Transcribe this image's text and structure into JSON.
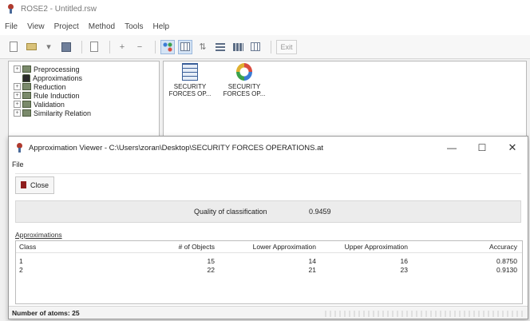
{
  "app": {
    "title": "ROSE2 - Untitled.rsw",
    "menu": [
      "File",
      "View",
      "Project",
      "Method",
      "Tools",
      "Help"
    ],
    "toolbar_text_button": "Exit"
  },
  "tree": {
    "items": [
      {
        "label": "Preprocessing",
        "expander": "+",
        "icon": "folder-icon"
      },
      {
        "label": "Approximations",
        "expander": "",
        "icon": "runner-icon"
      },
      {
        "label": "Reduction",
        "expander": "+",
        "icon": "folder-icon"
      },
      {
        "label": "Rule Induction",
        "expander": "+",
        "icon": "folder-icon"
      },
      {
        "label": "Validation",
        "expander": "+",
        "icon": "folder-icon"
      },
      {
        "label": "Similarity Relation",
        "expander": "+",
        "icon": "folder-icon"
      }
    ]
  },
  "workspace": {
    "items": [
      {
        "label_line1": "SECURITY",
        "label_line2": "FORCES OP...",
        "icon": "table-icon"
      },
      {
        "label_line1": "SECURITY",
        "label_line2": "FORCES OP...",
        "icon": "approximation-icon"
      }
    ]
  },
  "viewer": {
    "title": "Approximation Viewer - C:\\Users\\zoran\\Desktop\\SECURITY FORCES OPERATIONS.at",
    "menu_file": "File",
    "close_button": "Close",
    "quality_label": "Quality of classification",
    "quality_value": "0.9459",
    "approximations_label": "Approximations",
    "columns": [
      "Class",
      "# of Objects",
      "Lower Approximation",
      "Upper Approximation",
      "Accuracy"
    ],
    "rows": [
      [
        "1",
        "15",
        "14",
        "16",
        "0.8750"
      ],
      [
        "2",
        "22",
        "21",
        "23",
        "0.9130"
      ]
    ],
    "status": "Number of atoms: 25",
    "window_controls": {
      "minimize": "—",
      "maximize": "☐",
      "close": "✕"
    }
  },
  "colors": {
    "accent_selected": "#d5e4f5",
    "close_door": "#8e1c1c"
  }
}
